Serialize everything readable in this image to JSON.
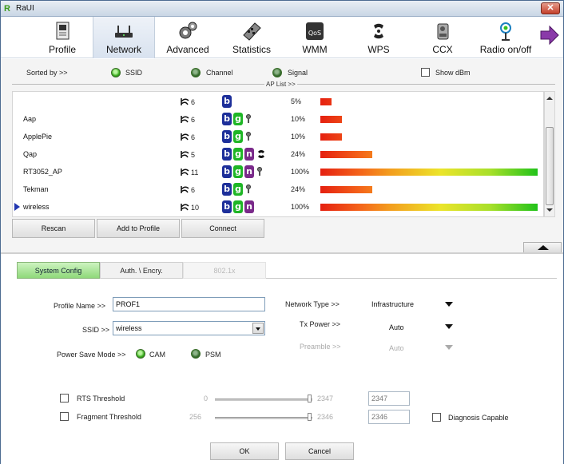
{
  "window": {
    "title": "RaUI",
    "close_label": "✕"
  },
  "toolbar": {
    "items": [
      {
        "label": "Profile",
        "icon": "profile-icon"
      },
      {
        "label": "Network",
        "icon": "network-icon"
      },
      {
        "label": "Advanced",
        "icon": "advanced-gear-icon"
      },
      {
        "label": "Statistics",
        "icon": "statistics-icon"
      },
      {
        "label": "WMM",
        "icon": "wmm-qos-icon"
      },
      {
        "label": "WPS",
        "icon": "wps-icon"
      },
      {
        "label": "CCX",
        "icon": "ccx-icon"
      },
      {
        "label": "Radio on/off",
        "icon": "radio-antenna-icon"
      }
    ],
    "active": "Network",
    "more_icon": "right-arrow-icon"
  },
  "sort": {
    "label": "Sorted by >>",
    "ssid": "SSID",
    "channel": "Channel",
    "signal": "Signal",
    "show_dbm": "Show dBm"
  },
  "aplist": {
    "title": "AP List >>",
    "rows": [
      {
        "ssid": "",
        "channel": "6",
        "modes": [
          "b"
        ],
        "locked": false,
        "signal": "5%",
        "signal_value": 5,
        "selected": false
      },
      {
        "ssid": "Aap",
        "channel": "6",
        "modes": [
          "b",
          "g"
        ],
        "locked": true,
        "signal": "10%",
        "signal_value": 10,
        "selected": false
      },
      {
        "ssid": "ApplePie",
        "channel": "6",
        "modes": [
          "b",
          "g"
        ],
        "locked": true,
        "signal": "10%",
        "signal_value": 10,
        "selected": false
      },
      {
        "ssid": "Qap",
        "channel": "5",
        "modes": [
          "b",
          "g",
          "n"
        ],
        "locked": false,
        "wps": true,
        "signal": "24%",
        "signal_value": 24,
        "selected": false
      },
      {
        "ssid": "RT3052_AP",
        "channel": "11",
        "modes": [
          "b",
          "g",
          "n"
        ],
        "locked": true,
        "signal": "100%",
        "signal_value": 100,
        "selected": false
      },
      {
        "ssid": "Tekman",
        "channel": "6",
        "modes": [
          "b",
          "g"
        ],
        "locked": true,
        "signal": "24%",
        "signal_value": 24,
        "selected": false
      },
      {
        "ssid": "wireless",
        "channel": "10",
        "modes": [
          "b",
          "g",
          "n"
        ],
        "locked": false,
        "signal": "100%",
        "signal_value": 100,
        "selected": true
      }
    ]
  },
  "buttons": {
    "rescan": "Rescan",
    "add_to_profile": "Add to Profile",
    "connect": "Connect",
    "ok": "OK",
    "cancel": "Cancel"
  },
  "tabs": {
    "system_config": "System Config",
    "auth": "Auth. \\ Encry.",
    "dot1x": "802.1x"
  },
  "config": {
    "profile_name_label": "Profile Name >>",
    "profile_name": "PROF1",
    "ssid_label": "SSID >>",
    "ssid": "wireless",
    "power_save_label": "Power Save Mode >>",
    "cam": "CAM",
    "psm": "PSM",
    "network_type_label": "Network Type >>",
    "network_type": "Infrastructure",
    "tx_power_label": "Tx Power >>",
    "tx_power": "Auto",
    "preamble_label": "Preamble >>",
    "preamble": "Auto",
    "rts_label": "RTS Threshold",
    "rts_min": "0",
    "rts_max": "2347",
    "rts_value": "2347",
    "frag_label": "Fragment Threshold",
    "frag_min": "256",
    "frag_max": "2346",
    "frag_value": "2346",
    "diagnosis_label": "Diagnosis Capable"
  }
}
